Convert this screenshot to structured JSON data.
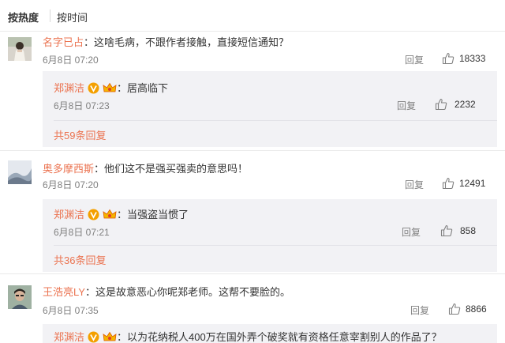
{
  "sort": {
    "hot_label": "按热度",
    "time_label": "按时间"
  },
  "colors": {
    "username": "#eb7350",
    "meta": "#808080",
    "reply_bg": "#f2f2f5"
  },
  "comments": [
    {
      "user": "名字已占",
      "text": "：这啥毛病，不跟作者接触，直接短信通知？",
      "time": "6月8日 07:20",
      "reply_label": "回复",
      "likes": "18333",
      "reply": {
        "user": "郑渊洁",
        "text": "：居高临下",
        "time": "6月8日 07:23",
        "reply_label": "回复",
        "likes": "2232"
      },
      "more": "共59条回复"
    },
    {
      "user": "奥多摩西斯",
      "text": "：他们这不是强买强卖的意思吗！",
      "time": "6月8日 07:20",
      "reply_label": "回复",
      "likes": "12491",
      "reply": {
        "user": "郑渊洁",
        "text": "：当强盗当惯了",
        "time": "6月8日 07:21",
        "reply_label": "回复",
        "likes": "858"
      },
      "more": "共36条回复"
    },
    {
      "user": "王浩亮LY",
      "text": "：这是故意恶心你呢郑老师。这帮不要脸的。",
      "time": "6月8日 07:35",
      "reply_label": "回复",
      "likes": "8866",
      "reply": {
        "user": "郑渊洁",
        "text": "：以为花纳税人400万在国外弄个破奖就有资格任意宰割别人的作品了？"
      }
    }
  ],
  "icons": {
    "like": "thumbs-up-icon",
    "verified": "verified-v-icon",
    "crown": "crown-icon"
  }
}
